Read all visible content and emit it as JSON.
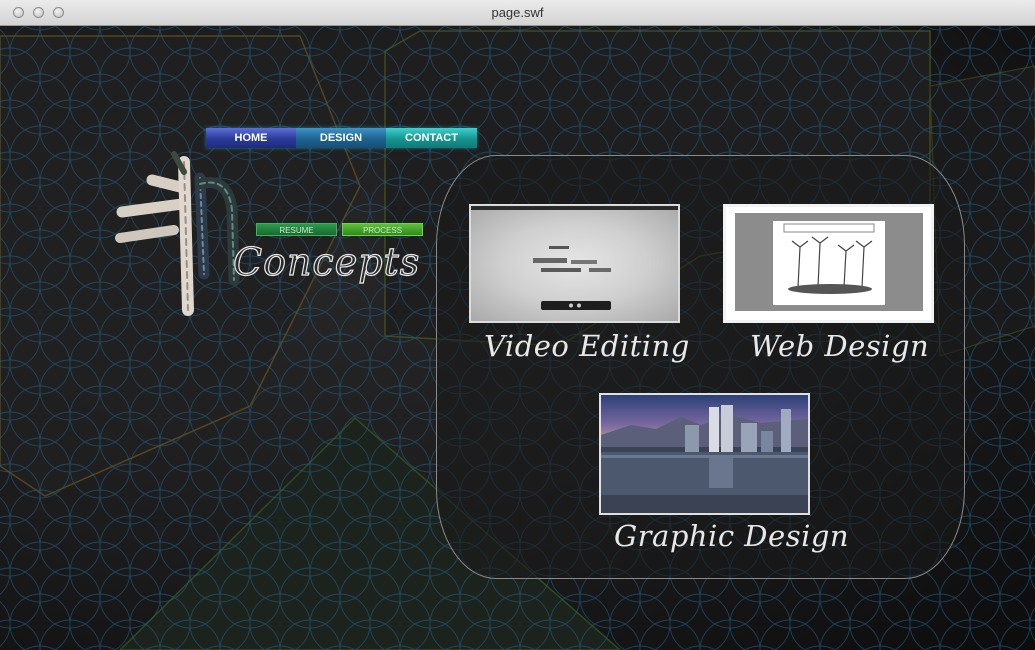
{
  "window": {
    "title": "page.swf"
  },
  "nav": {
    "home": "HOME",
    "design": "DESIGN",
    "contact": "CONTACT"
  },
  "subnav": {
    "resume": "RESUME",
    "process": "PROCESS"
  },
  "logo": {
    "text": "Concepts"
  },
  "portfolio": {
    "video": {
      "label": "Video Editing",
      "icon": "video-player-thumbnail"
    },
    "web": {
      "label": "Web Design",
      "icon": "web-page-thumbnail"
    },
    "graphic": {
      "label": "Graphic Design",
      "icon": "city-skyline-thumbnail"
    }
  },
  "colors": {
    "nav_home": "#2b3a9a",
    "nav_design": "#1d628f",
    "nav_contact": "#15948f",
    "resume_button": "#18692f",
    "process_button": "#2f8a1c",
    "pattern_line": "#1f5d86"
  }
}
